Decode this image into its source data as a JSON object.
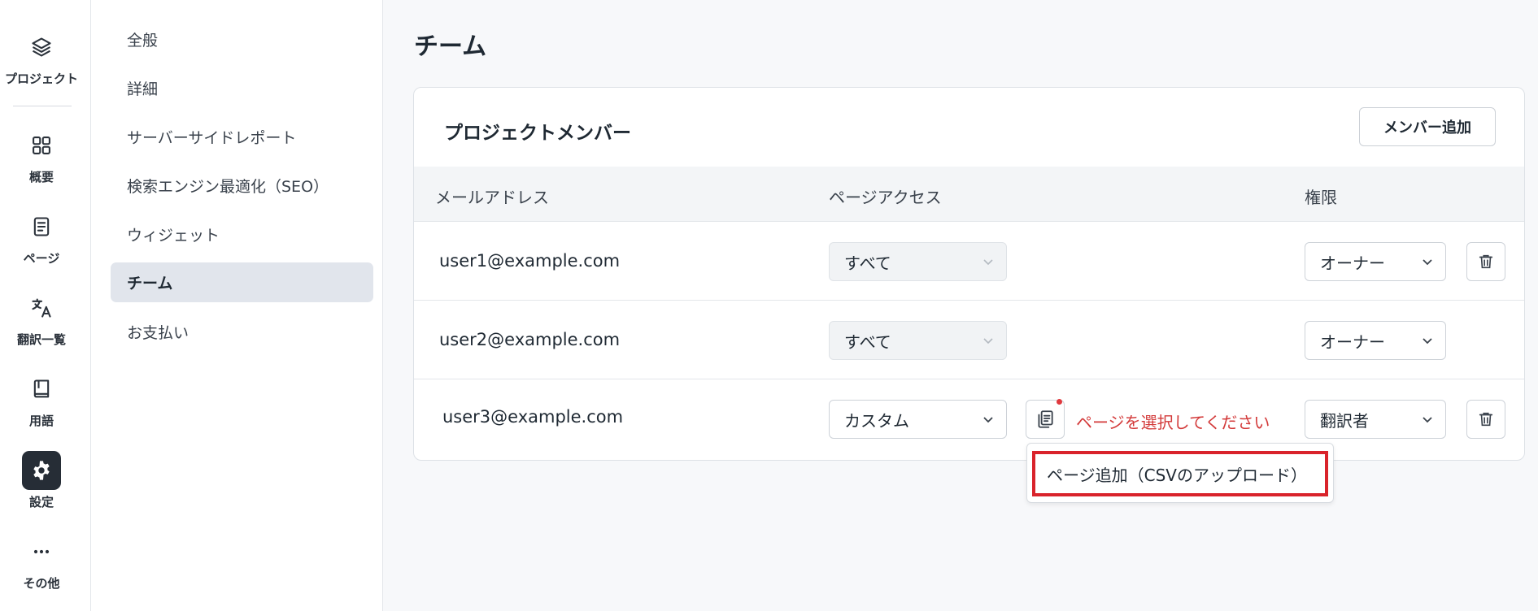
{
  "rail": {
    "items": [
      {
        "label": "プロジェクト",
        "icon": "layers-icon"
      },
      {
        "label": "概要",
        "icon": "grid-icon"
      },
      {
        "label": "ページ",
        "icon": "document-icon"
      },
      {
        "label": "翻訳一覧",
        "icon": "translate-icon"
      },
      {
        "label": "用語",
        "icon": "book-icon"
      },
      {
        "label": "設定",
        "icon": "gear-icon",
        "active": true
      },
      {
        "label": "その他",
        "icon": "more-icon"
      }
    ]
  },
  "menu": {
    "items": [
      {
        "label": "全般"
      },
      {
        "label": "詳細"
      },
      {
        "label": "サーバーサイドレポート"
      },
      {
        "label": "検索エンジン最適化（SEO）"
      },
      {
        "label": "ウィジェット"
      },
      {
        "label": "チーム",
        "active": true
      },
      {
        "label": "お支払い"
      }
    ]
  },
  "page": {
    "title": "チーム"
  },
  "card": {
    "title": "プロジェクトメンバー",
    "add_member_label": "メンバー追加",
    "columns": {
      "email": "メールアドレス",
      "page_access": "ページアクセス",
      "role": "権限"
    },
    "rows": [
      {
        "email": "user1@example.com",
        "page_access": "すべて",
        "role": "オーナー",
        "deletable": true
      },
      {
        "email": "user2@example.com",
        "page_access": "すべて",
        "role": "オーナー",
        "deletable": false
      },
      {
        "email": "user3@example.com",
        "page_access": "カスタム",
        "role": "翻訳者",
        "deletable": true,
        "error": "ページを選択してください"
      }
    ]
  },
  "popover": {
    "item_label": "ページ追加（CSVのアップロード）"
  },
  "colors": {
    "error": "#d33a3a",
    "highlight_border": "#d9232b",
    "active_rail_bg": "#262d36"
  }
}
